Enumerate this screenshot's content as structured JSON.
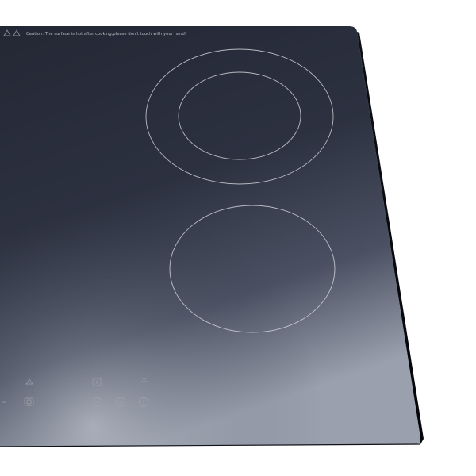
{
  "product": {
    "type": "ceramic glass cooktop",
    "surface_color": "#1f232c"
  },
  "caution": {
    "text": "Caution: The surface is hot after cooking,please don't touch with your hand!",
    "icons": [
      "hot-surface-warning-icon",
      "hand-warning-icon"
    ]
  },
  "cooking_zones": [
    {
      "name": "dual-ring-zone",
      "rings": 2
    },
    {
      "name": "single-ring-zone",
      "rings": 1
    }
  ],
  "touch_controls": {
    "icons": [
      "lock-icon",
      "power-icon",
      "timer-icon",
      "minus-icon",
      "zone-select-icon",
      "plus-icon",
      "info-icon",
      "ring-select-icon"
    ]
  }
}
